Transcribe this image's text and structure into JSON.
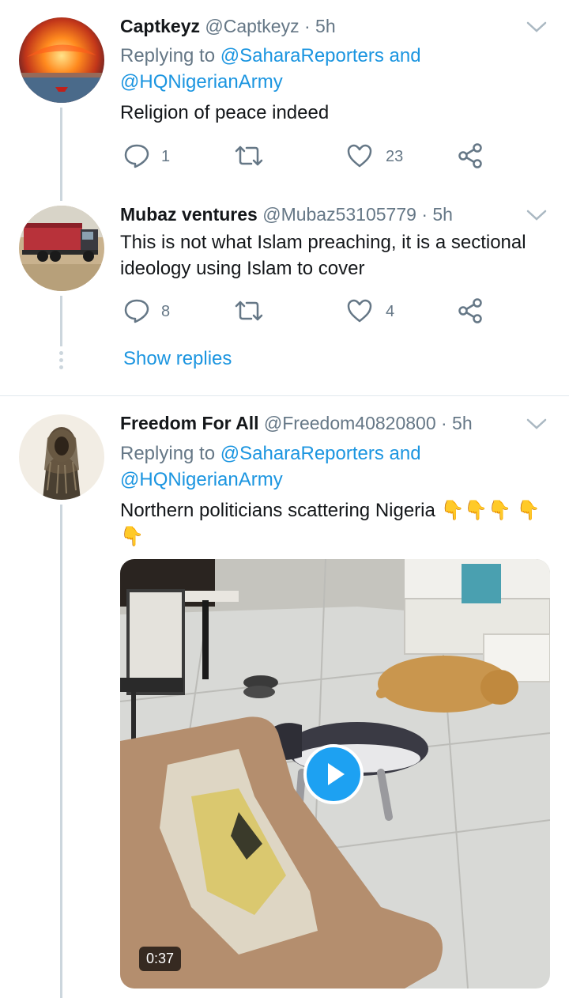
{
  "tweets": [
    {
      "name": "Captkeyz",
      "handle": "@Captkeyz",
      "time": "· 5h",
      "replying_prefix": "Replying to ",
      "replying_to_1": "@SaharaReporters and",
      "replying_to_2": "@HQNigerianArmy",
      "text": "Religion of peace indeed",
      "replies": "1",
      "likes": "23"
    },
    {
      "name": "Mubaz ventures",
      "handle": "@Mubaz53105779",
      "time": "· 5h",
      "text": "This is not what Islam preaching, it is a sectional ideology using Islam to cover",
      "replies": "8",
      "likes": "4"
    },
    {
      "name": "Freedom For All",
      "handle": "@Freedom40820800",
      "time": "· 5h",
      "replying_prefix": "Replying to ",
      "replying_to_1": "@SaharaReporters and",
      "replying_to_2": "@HQNigerianArmy",
      "text": "Northern politicians scattering Nigeria",
      "emoji": "👇👇👇 👇👇",
      "video_duration": "0:37"
    }
  ],
  "show_replies_label": "Show replies",
  "icons": [
    "reply-icon",
    "retweet-icon",
    "like-icon",
    "share-icon",
    "chevron-down-icon",
    "play-icon"
  ],
  "colors": {
    "link": "#1b95e0",
    "secondary": "#657786",
    "thread": "#ccd6dd",
    "play": "#1da1f2"
  }
}
